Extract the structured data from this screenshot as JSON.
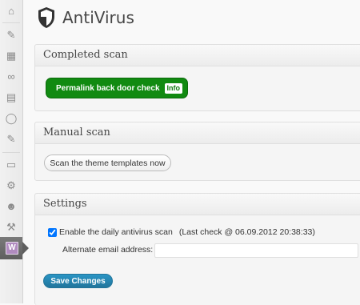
{
  "header": {
    "title": "AntiVirus"
  },
  "sidebar": {
    "icons": [
      "dashboard-icon",
      "posts-icon",
      "media-icon",
      "links-icon",
      "pages-icon",
      "comments-icon",
      "feedback-icon",
      "appearance-icon",
      "plugins-icon",
      "users-icon",
      "tools-icon",
      "settings-icon"
    ]
  },
  "completed_scan": {
    "title": "Completed scan",
    "result_label": "Permalink back door check",
    "info_label": "Info",
    "result_color": "#118a11"
  },
  "manual_scan": {
    "title": "Manual scan",
    "button_label": "Scan the theme templates now"
  },
  "settings": {
    "title": "Settings",
    "daily_scan_label": "Enable the daily antivirus scan",
    "daily_scan_checked": true,
    "last_check": "(Last check @ 06.09.2012 20:38:33)",
    "email_label": "Alternate email address:",
    "email_value": "",
    "save_label": "Save Changes",
    "save_color": "#21759b"
  }
}
